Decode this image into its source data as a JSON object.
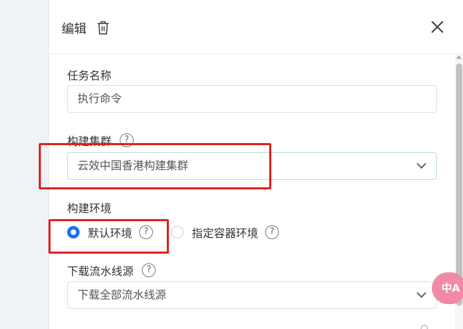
{
  "header": {
    "title": "编辑"
  },
  "form": {
    "task_name_label": "任务名称",
    "task_name_value": "执行命令",
    "cluster_label": "构建集群",
    "cluster_value": "云效中国香港构建集群",
    "env_label": "构建环境",
    "env_options": [
      {
        "label": "默认环境",
        "checked": true
      },
      {
        "label": "指定容器环境",
        "checked": false
      }
    ],
    "source_label": "下载流水线源",
    "source_value": "下载全部流水线源",
    "help_glyph": "?"
  },
  "fab": {
    "label": "中A"
  },
  "colors": {
    "accent": "#1b73e8",
    "highlight": "#e0201c",
    "fab": "#f08aa8"
  }
}
